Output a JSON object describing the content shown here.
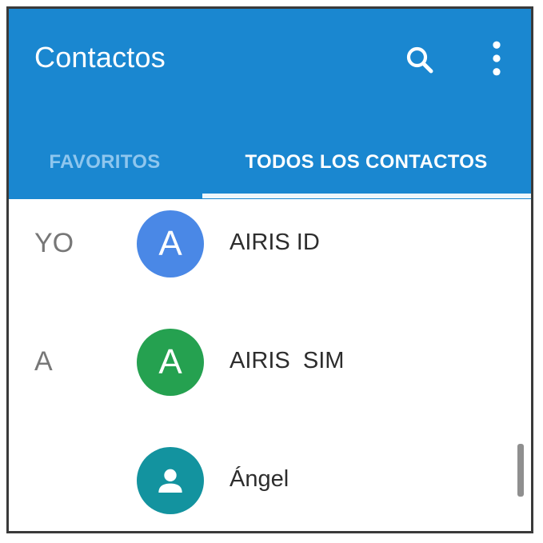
{
  "app": {
    "title": "Contactos",
    "accent_color": "#1a87d0",
    "icons": {
      "search": "search-icon",
      "menu": "more-vert-icon"
    }
  },
  "tabs": [
    {
      "label": "FAVORITOS",
      "selected": false
    },
    {
      "label": "TODOS LOS CONTACTOS",
      "selected": true
    }
  ],
  "contacts": [
    {
      "section": "YO",
      "initial": "A",
      "name": "AIRIS ID",
      "avatar_color": "#4a88e6"
    },
    {
      "section": "A",
      "initial": "A",
      "name": "AIRIS  SIM",
      "avatar_color": "#25a150"
    },
    {
      "section": "",
      "initial": "",
      "name": "Ángel",
      "avatar_color": "#13939f",
      "avatar_icon": "person-icon"
    }
  ]
}
